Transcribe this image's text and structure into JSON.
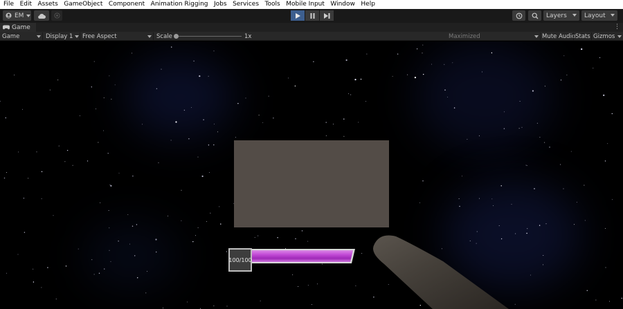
{
  "menu": [
    "File",
    "Edit",
    "Assets",
    "GameObject",
    "Component",
    "Animation Rigging",
    "Jobs",
    "Services",
    "Tools",
    "Mobile Input",
    "Window",
    "Help"
  ],
  "toolbar": {
    "account_label": "EM",
    "layers_label": "Layers",
    "layout_label": "Layout"
  },
  "tab": {
    "label": "Game"
  },
  "game_toolbar": {
    "mode": "Game",
    "display": "Display 1",
    "aspect": "Free Aspect",
    "scale_label": "Scale",
    "scale_value": "1x",
    "maximized": "Maximized",
    "mute_audio": "Mute Audio",
    "stats": "Stats",
    "gizmos": "Gizmos"
  },
  "hud": {
    "health_text": "100/100",
    "health_fraction": 1.0,
    "bar_color": "#c44dd8"
  }
}
